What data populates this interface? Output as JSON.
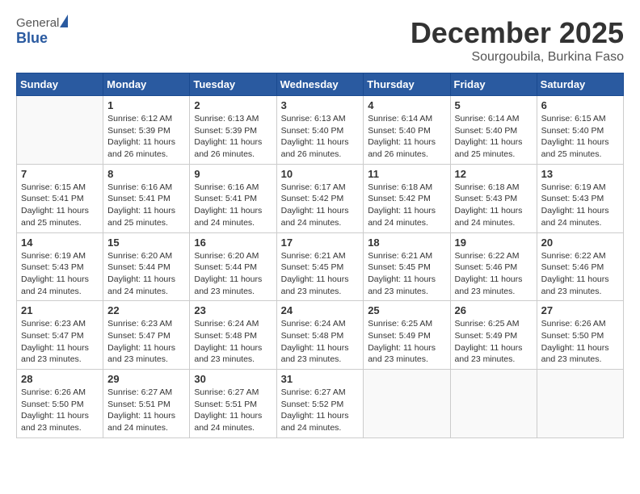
{
  "header": {
    "logo_general": "General",
    "logo_blue": "Blue",
    "month_title": "December 2025",
    "location": "Sourgoubila, Burkina Faso"
  },
  "weekdays": [
    "Sunday",
    "Monday",
    "Tuesday",
    "Wednesday",
    "Thursday",
    "Friday",
    "Saturday"
  ],
  "weeks": [
    [
      {
        "day": "",
        "info": ""
      },
      {
        "day": "1",
        "info": "Sunrise: 6:12 AM\nSunset: 5:39 PM\nDaylight: 11 hours\nand 26 minutes."
      },
      {
        "day": "2",
        "info": "Sunrise: 6:13 AM\nSunset: 5:39 PM\nDaylight: 11 hours\nand 26 minutes."
      },
      {
        "day": "3",
        "info": "Sunrise: 6:13 AM\nSunset: 5:40 PM\nDaylight: 11 hours\nand 26 minutes."
      },
      {
        "day": "4",
        "info": "Sunrise: 6:14 AM\nSunset: 5:40 PM\nDaylight: 11 hours\nand 26 minutes."
      },
      {
        "day": "5",
        "info": "Sunrise: 6:14 AM\nSunset: 5:40 PM\nDaylight: 11 hours\nand 25 minutes."
      },
      {
        "day": "6",
        "info": "Sunrise: 6:15 AM\nSunset: 5:40 PM\nDaylight: 11 hours\nand 25 minutes."
      }
    ],
    [
      {
        "day": "7",
        "info": "Sunrise: 6:15 AM\nSunset: 5:41 PM\nDaylight: 11 hours\nand 25 minutes."
      },
      {
        "day": "8",
        "info": "Sunrise: 6:16 AM\nSunset: 5:41 PM\nDaylight: 11 hours\nand 25 minutes."
      },
      {
        "day": "9",
        "info": "Sunrise: 6:16 AM\nSunset: 5:41 PM\nDaylight: 11 hours\nand 24 minutes."
      },
      {
        "day": "10",
        "info": "Sunrise: 6:17 AM\nSunset: 5:42 PM\nDaylight: 11 hours\nand 24 minutes."
      },
      {
        "day": "11",
        "info": "Sunrise: 6:18 AM\nSunset: 5:42 PM\nDaylight: 11 hours\nand 24 minutes."
      },
      {
        "day": "12",
        "info": "Sunrise: 6:18 AM\nSunset: 5:43 PM\nDaylight: 11 hours\nand 24 minutes."
      },
      {
        "day": "13",
        "info": "Sunrise: 6:19 AM\nSunset: 5:43 PM\nDaylight: 11 hours\nand 24 minutes."
      }
    ],
    [
      {
        "day": "14",
        "info": "Sunrise: 6:19 AM\nSunset: 5:43 PM\nDaylight: 11 hours\nand 24 minutes."
      },
      {
        "day": "15",
        "info": "Sunrise: 6:20 AM\nSunset: 5:44 PM\nDaylight: 11 hours\nand 24 minutes."
      },
      {
        "day": "16",
        "info": "Sunrise: 6:20 AM\nSunset: 5:44 PM\nDaylight: 11 hours\nand 23 minutes."
      },
      {
        "day": "17",
        "info": "Sunrise: 6:21 AM\nSunset: 5:45 PM\nDaylight: 11 hours\nand 23 minutes."
      },
      {
        "day": "18",
        "info": "Sunrise: 6:21 AM\nSunset: 5:45 PM\nDaylight: 11 hours\nand 23 minutes."
      },
      {
        "day": "19",
        "info": "Sunrise: 6:22 AM\nSunset: 5:46 PM\nDaylight: 11 hours\nand 23 minutes."
      },
      {
        "day": "20",
        "info": "Sunrise: 6:22 AM\nSunset: 5:46 PM\nDaylight: 11 hours\nand 23 minutes."
      }
    ],
    [
      {
        "day": "21",
        "info": "Sunrise: 6:23 AM\nSunset: 5:47 PM\nDaylight: 11 hours\nand 23 minutes."
      },
      {
        "day": "22",
        "info": "Sunrise: 6:23 AM\nSunset: 5:47 PM\nDaylight: 11 hours\nand 23 minutes."
      },
      {
        "day": "23",
        "info": "Sunrise: 6:24 AM\nSunset: 5:48 PM\nDaylight: 11 hours\nand 23 minutes."
      },
      {
        "day": "24",
        "info": "Sunrise: 6:24 AM\nSunset: 5:48 PM\nDaylight: 11 hours\nand 23 minutes."
      },
      {
        "day": "25",
        "info": "Sunrise: 6:25 AM\nSunset: 5:49 PM\nDaylight: 11 hours\nand 23 minutes."
      },
      {
        "day": "26",
        "info": "Sunrise: 6:25 AM\nSunset: 5:49 PM\nDaylight: 11 hours\nand 23 minutes."
      },
      {
        "day": "27",
        "info": "Sunrise: 6:26 AM\nSunset: 5:50 PM\nDaylight: 11 hours\nand 23 minutes."
      }
    ],
    [
      {
        "day": "28",
        "info": "Sunrise: 6:26 AM\nSunset: 5:50 PM\nDaylight: 11 hours\nand 23 minutes."
      },
      {
        "day": "29",
        "info": "Sunrise: 6:27 AM\nSunset: 5:51 PM\nDaylight: 11 hours\nand 24 minutes."
      },
      {
        "day": "30",
        "info": "Sunrise: 6:27 AM\nSunset: 5:51 PM\nDaylight: 11 hours\nand 24 minutes."
      },
      {
        "day": "31",
        "info": "Sunrise: 6:27 AM\nSunset: 5:52 PM\nDaylight: 11 hours\nand 24 minutes."
      },
      {
        "day": "",
        "info": ""
      },
      {
        "day": "",
        "info": ""
      },
      {
        "day": "",
        "info": ""
      }
    ]
  ]
}
